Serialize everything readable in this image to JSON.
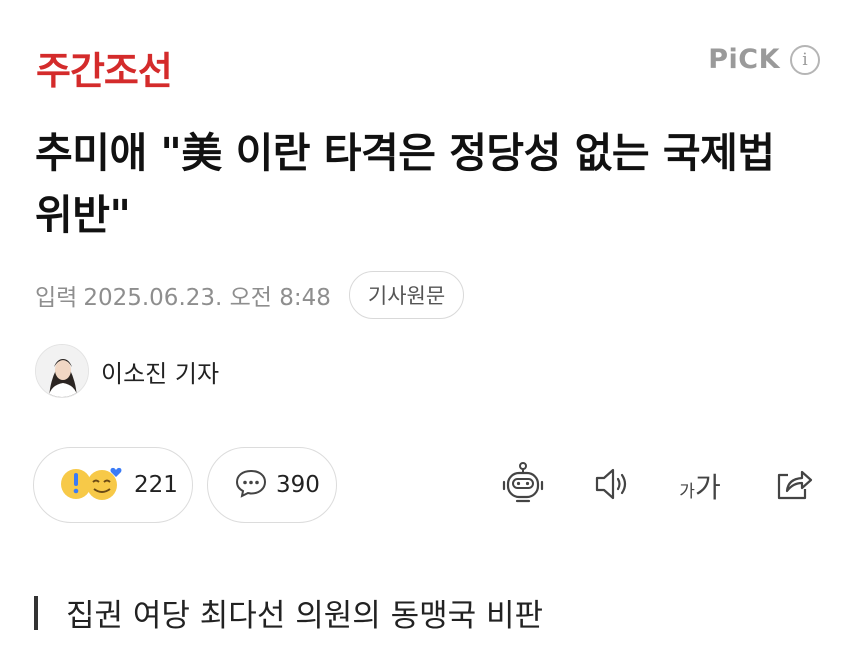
{
  "header": {
    "brand": "주간조선",
    "pick_label": "PiCK",
    "info_symbol": "i"
  },
  "article": {
    "headline": "추미애 \"美 이란 타격은 정당성 없는 국제법 위반\"",
    "published_label": "입력",
    "published_date": "2025.06.23. 오전 8:48",
    "original_button": "기사원문",
    "author": "이소진 기자",
    "subheading": "집권 여당 최다선 의원의 동맹국 비판"
  },
  "reactions": {
    "reaction_count": "221",
    "comment_count": "390"
  },
  "toolbar": {
    "font_small": "가",
    "font_large": "가",
    "icons": [
      "robot-summary-icon",
      "speaker-icon",
      "font-size-icon",
      "share-icon"
    ]
  },
  "colors": {
    "brand": "#d42b2b",
    "muted": "#8e8e8e",
    "border": "#dcdcdc",
    "emoji_yellow": "#f7c948",
    "emoji_blue": "#3b7bf6"
  }
}
